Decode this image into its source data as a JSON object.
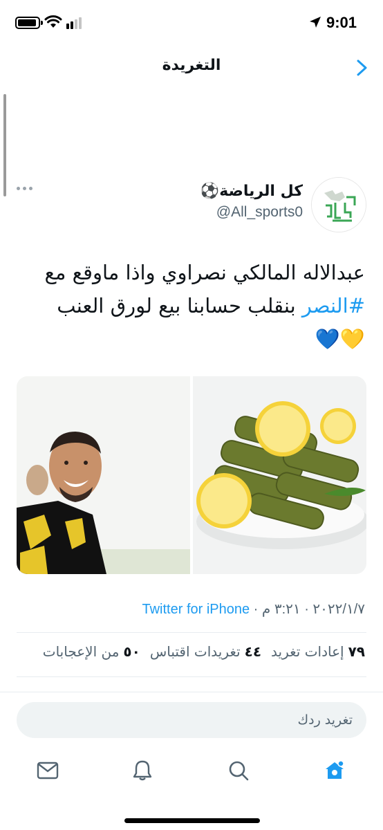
{
  "status_bar": {
    "time": "9:01"
  },
  "header": {
    "title": "التغريدة"
  },
  "tweet": {
    "author_name": "كل الرياضة⚽️",
    "author_handle": "@All_sports0",
    "text_line1": "عبدالاله المالكي نصراوي واذا ماوقع مع",
    "hashtag": "#النصر",
    "text_line2_rest": " بنقلب حسابنا بيع لورق العنب",
    "emojis": "💛💙",
    "date_time": "٢٠٢٢/١/٧ · ٣:٢١ م · ",
    "source": "Twitter for iPhone",
    "stats": {
      "retweets_count": "٧٩",
      "retweets_label": "إعادات تغريد",
      "quotes_count": "٤٤",
      "quotes_label": "تغريدات اقتباس",
      "likes_count": "٥٠",
      "likes_label": "من الإعجابات"
    }
  },
  "reply": {
    "placeholder": "تغريد ردك"
  },
  "tabbar": {
    "items": [
      "home-icon",
      "search-icon",
      "bell-icon",
      "mail-icon"
    ],
    "accent": "#1d9bf0"
  },
  "colors": {
    "accent": "#1d9bf0",
    "text": "#0f1419",
    "secondary": "#536471"
  }
}
